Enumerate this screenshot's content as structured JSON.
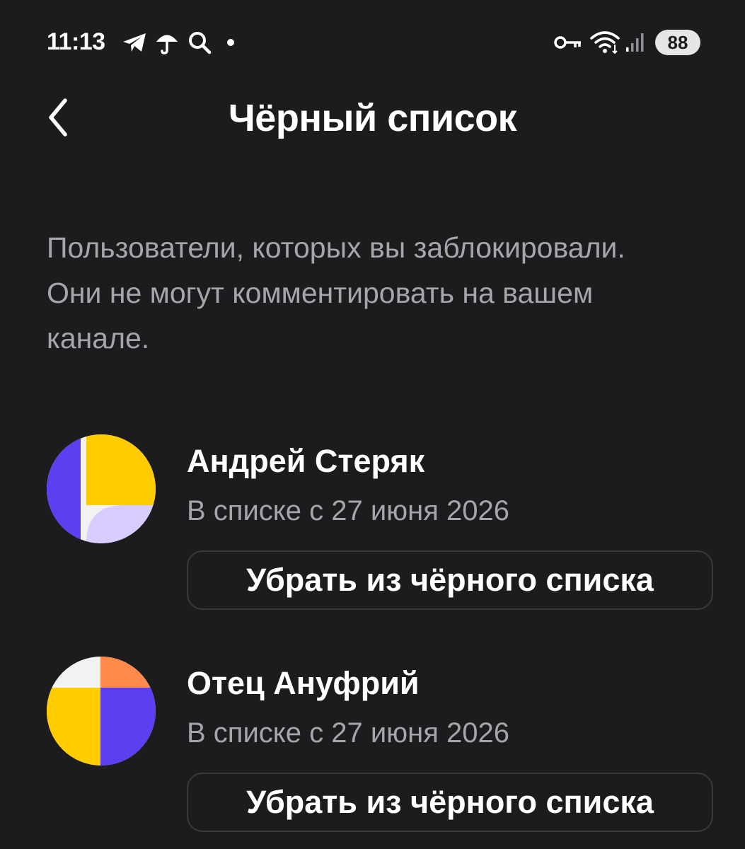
{
  "status_bar": {
    "time": "11:13",
    "battery": "88",
    "left_icons": [
      "telegram-icon",
      "umbrella-icon",
      "search-icon",
      "dot-icon"
    ],
    "right_icons": [
      "key-icon",
      "wifi-icon",
      "signal-icon"
    ]
  },
  "header": {
    "title": "Чёрный список",
    "back_icon": "chevron-left-icon"
  },
  "description": "Пользователи, которых вы заблокировали. Они не могут комментировать на вашем канале.",
  "blocked_users": [
    {
      "name": "Андрей Стеряк",
      "date": "В списке с 27 июня 2026",
      "button_label": "Убрать из чёрного списка"
    },
    {
      "name": "Отец Ануфрий",
      "date": "В списке с 27 июня 2026",
      "button_label": "Убрать из чёрного списка"
    }
  ],
  "colors": {
    "background": "#1c1c1e",
    "text_primary": "#ffffff",
    "text_secondary": "#a6a6aa",
    "button_border": "#3a3a3c",
    "avatar_yellow": "#ffcc00",
    "avatar_purple": "#5b3ff0",
    "avatar_lilac": "#d9ccff",
    "avatar_orange": "#ff8a4c",
    "avatar_white": "#f2f2f2"
  }
}
